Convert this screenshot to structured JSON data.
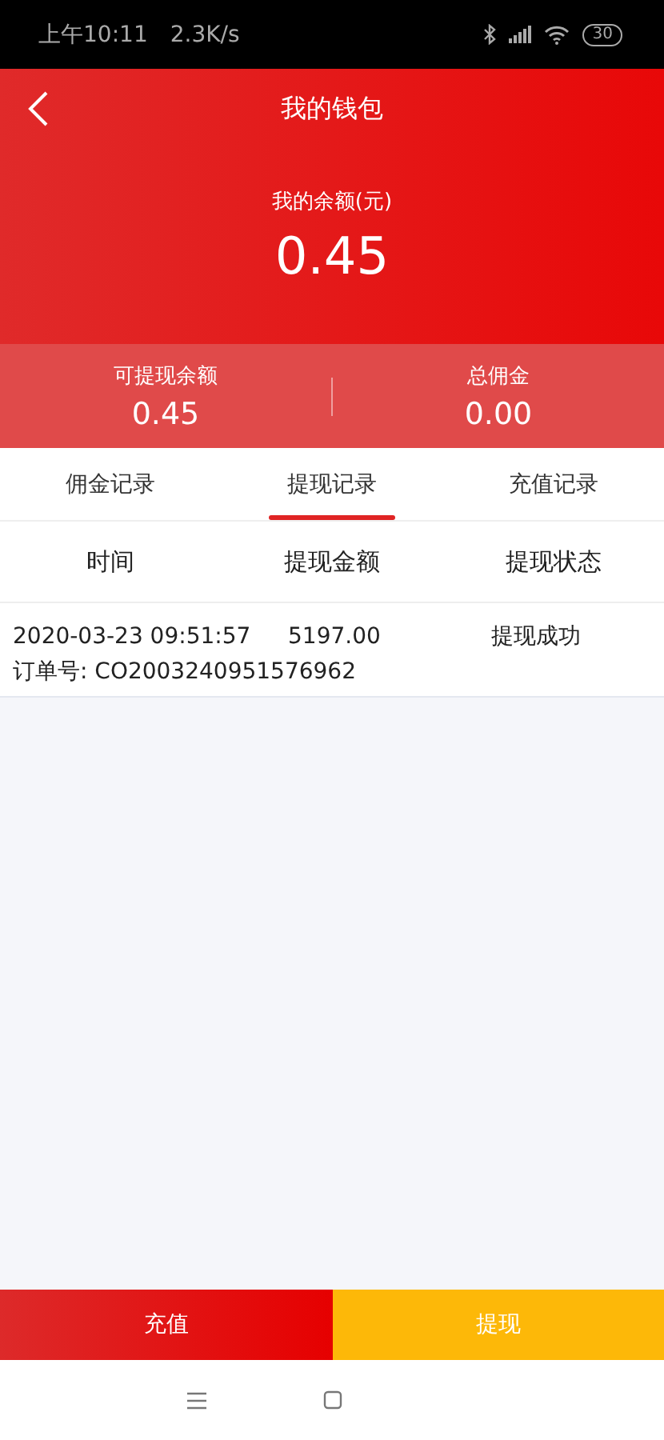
{
  "status_bar": {
    "time": "上午10:11",
    "speed": "2.3K/s",
    "battery": "30"
  },
  "header": {
    "title": "我的钱包"
  },
  "balance": {
    "label": "我的余额(元)",
    "amount": "0.45"
  },
  "summary": [
    {
      "label": "可提现余额",
      "value": "0.45"
    },
    {
      "label": "总佣金",
      "value": "0.00"
    }
  ],
  "tabs": [
    {
      "label": "佣金记录",
      "selected": false
    },
    {
      "label": "提现记录",
      "selected": true
    },
    {
      "label": "充值记录",
      "selected": false
    }
  ],
  "table": {
    "columns": [
      "时间",
      "提现金额",
      "提现状态"
    ],
    "rows": [
      {
        "time": "2020-03-23 09:51:57",
        "amount": "5197.00",
        "status": "提现成功",
        "order": "订单号: CO2003240951576962"
      }
    ]
  },
  "actions": [
    {
      "label": "充值",
      "kind": "primary"
    },
    {
      "label": "提现",
      "kind": "secondary"
    }
  ]
}
